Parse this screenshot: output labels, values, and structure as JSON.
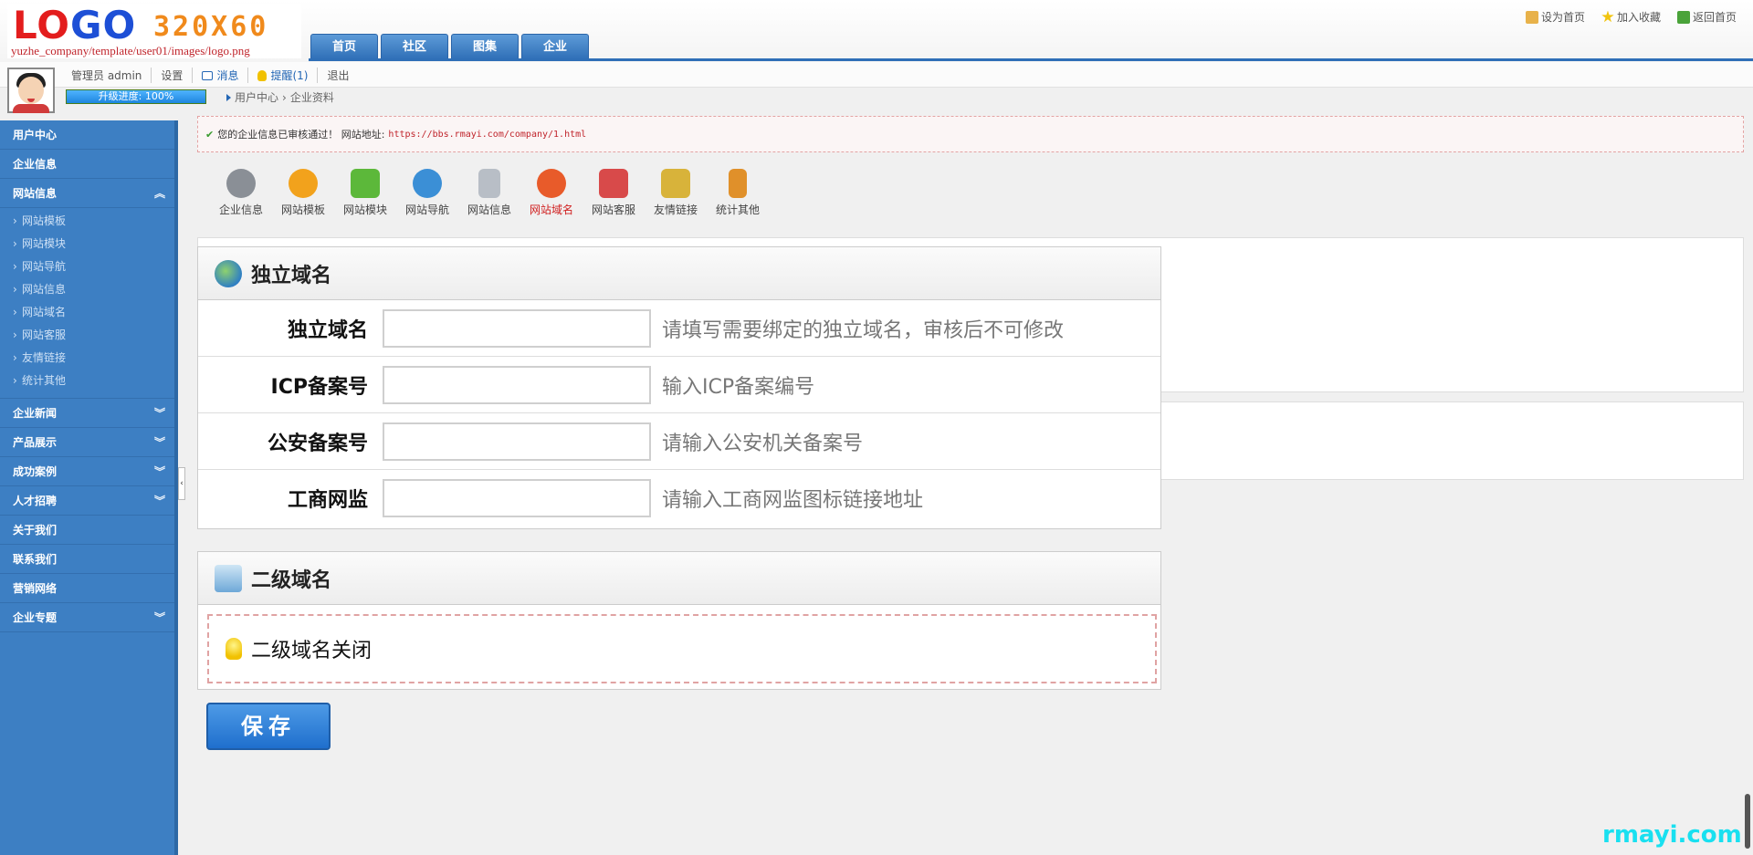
{
  "header": {
    "logo_part1": "LO",
    "logo_part2": "GO",
    "logo_size": "320X60",
    "logo_path": "yuzhe_company/template/user01/images/logo.png",
    "nav_tabs": [
      "首页",
      "社区",
      "图集",
      "企业"
    ],
    "top_links": {
      "set_home": "设为首页",
      "add_fav": "加入收藏",
      "back_home": "返回首页"
    }
  },
  "userbar": {
    "admin_label": "管理员 admin",
    "settings": "设置",
    "messages": "消息",
    "reminders": "提醒(1)",
    "logout": "退出",
    "progress_label": "升级进度: 100%",
    "progress_value": 100
  },
  "breadcrumb": {
    "home": "用户中心",
    "current": "企业资料"
  },
  "sidebar": {
    "groups": [
      {
        "label": "用户中心"
      },
      {
        "label": "企业信息"
      },
      {
        "label": "网站信息",
        "sub": [
          "网站模板",
          "网站模块",
          "网站导航",
          "网站信息",
          "网站域名",
          "网站客服",
          "友情链接",
          "统计其他"
        ]
      },
      {
        "label": "企业新闻"
      },
      {
        "label": "产品展示"
      },
      {
        "label": "成功案例"
      },
      {
        "label": "人才招聘"
      },
      {
        "label": "关于我们"
      },
      {
        "label": "联系我们"
      },
      {
        "label": "营销网络"
      },
      {
        "label": "企业专题"
      }
    ],
    "collapse_glyph": "‹"
  },
  "notice": {
    "text": "您的企业信息已审核通过！ 网站地址:",
    "url": "https://bbs.rmayi.com/company/1.html"
  },
  "toolbar": [
    {
      "label": "企业信息",
      "color": "#8a8f96"
    },
    {
      "label": "网站模板",
      "color": "#f2a21c"
    },
    {
      "label": "网站模块",
      "color": "#5cb83a"
    },
    {
      "label": "网站导航",
      "color": "#3b8fd6"
    },
    {
      "label": "网站信息",
      "color": "#b8bec6"
    },
    {
      "label": "网站域名",
      "color": "#e85b2a",
      "active": true
    },
    {
      "label": "网站客服",
      "color": "#d84a4a"
    },
    {
      "label": "友情链接",
      "color": "#d8b33a"
    },
    {
      "label": "统计其他",
      "color": "#e0902a"
    }
  ],
  "domain_panel": {
    "title": "独立域名",
    "fields": [
      {
        "label": "独立域名",
        "value": "",
        "hint": "请填写需要绑定的独立域名，审核后不可修改"
      },
      {
        "label": "ICP备案号",
        "value": "",
        "hint": "输入ICP备案编号"
      },
      {
        "label": "公安备案号",
        "value": "",
        "hint": "请输入公安机关备案号"
      },
      {
        "label": "工商网监",
        "value": "",
        "hint": "请输入工商网监图标链接地址"
      }
    ]
  },
  "subdomain_panel": {
    "title": "二级域名",
    "status": "二级域名关闭"
  },
  "save_button": "保存",
  "watermark": "rmayi.com"
}
